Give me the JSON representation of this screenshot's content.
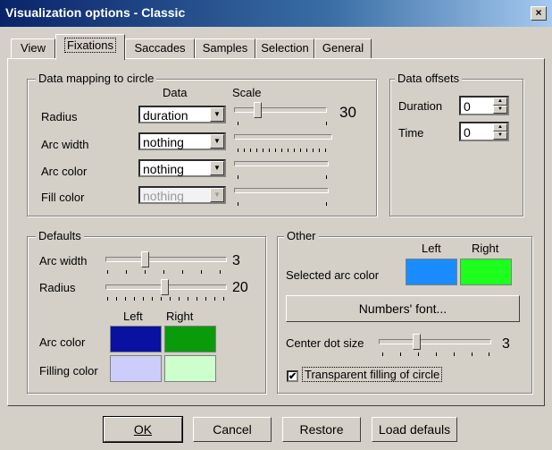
{
  "window": {
    "title": "Visualization options - Classic",
    "close_glyph": "×"
  },
  "tabs": [
    "View",
    "Fixations",
    "Saccades",
    "Samples",
    "Selection",
    "General"
  ],
  "active_tab": "Fixations",
  "mapping": {
    "legend": "Data mapping to circle",
    "col_data": "Data",
    "col_scale": "Scale",
    "radius_label": "Radius",
    "radius_value": "duration",
    "radius_scale": "30",
    "arcwidth_label": "Arc width",
    "arcwidth_value": "nothing",
    "arccolor_label": "Arc color",
    "arccolor_value": "nothing",
    "fillcolor_label": "Fill color",
    "fillcolor_value": "nothing"
  },
  "offsets": {
    "legend": "Data offsets",
    "duration_label": "Duration",
    "duration_value": "0",
    "time_label": "Time",
    "time_value": "0"
  },
  "defaults": {
    "legend": "Defaults",
    "arcwidth_label": "Arc width",
    "arcwidth_value": "3",
    "radius_label": "Radius",
    "radius_value": "20",
    "left_header": "Left",
    "right_header": "Right",
    "arccolor_label": "Arc color",
    "filling_label": "Filling color",
    "colors": {
      "arc_left": "#0a10a0",
      "arc_right": "#0a9b0a",
      "fill_left": "#cccdfa",
      "fill_right": "#ccffcc"
    }
  },
  "other": {
    "legend": "Other",
    "left_header": "Left",
    "right_header": "Right",
    "selected_label": "Selected arc color",
    "colors": {
      "sel_left": "#1a8cff",
      "sel_right": "#1dff1d"
    },
    "font_button": "Numbers' font...",
    "dot_label": "Center dot size",
    "dot_value": "3",
    "transparent_label": "Transparent filling of circle",
    "transparent_checked": "✔"
  },
  "buttons": {
    "ok": "OK",
    "cancel": "Cancel",
    "restore": "Restore",
    "load": "Load defauls"
  }
}
